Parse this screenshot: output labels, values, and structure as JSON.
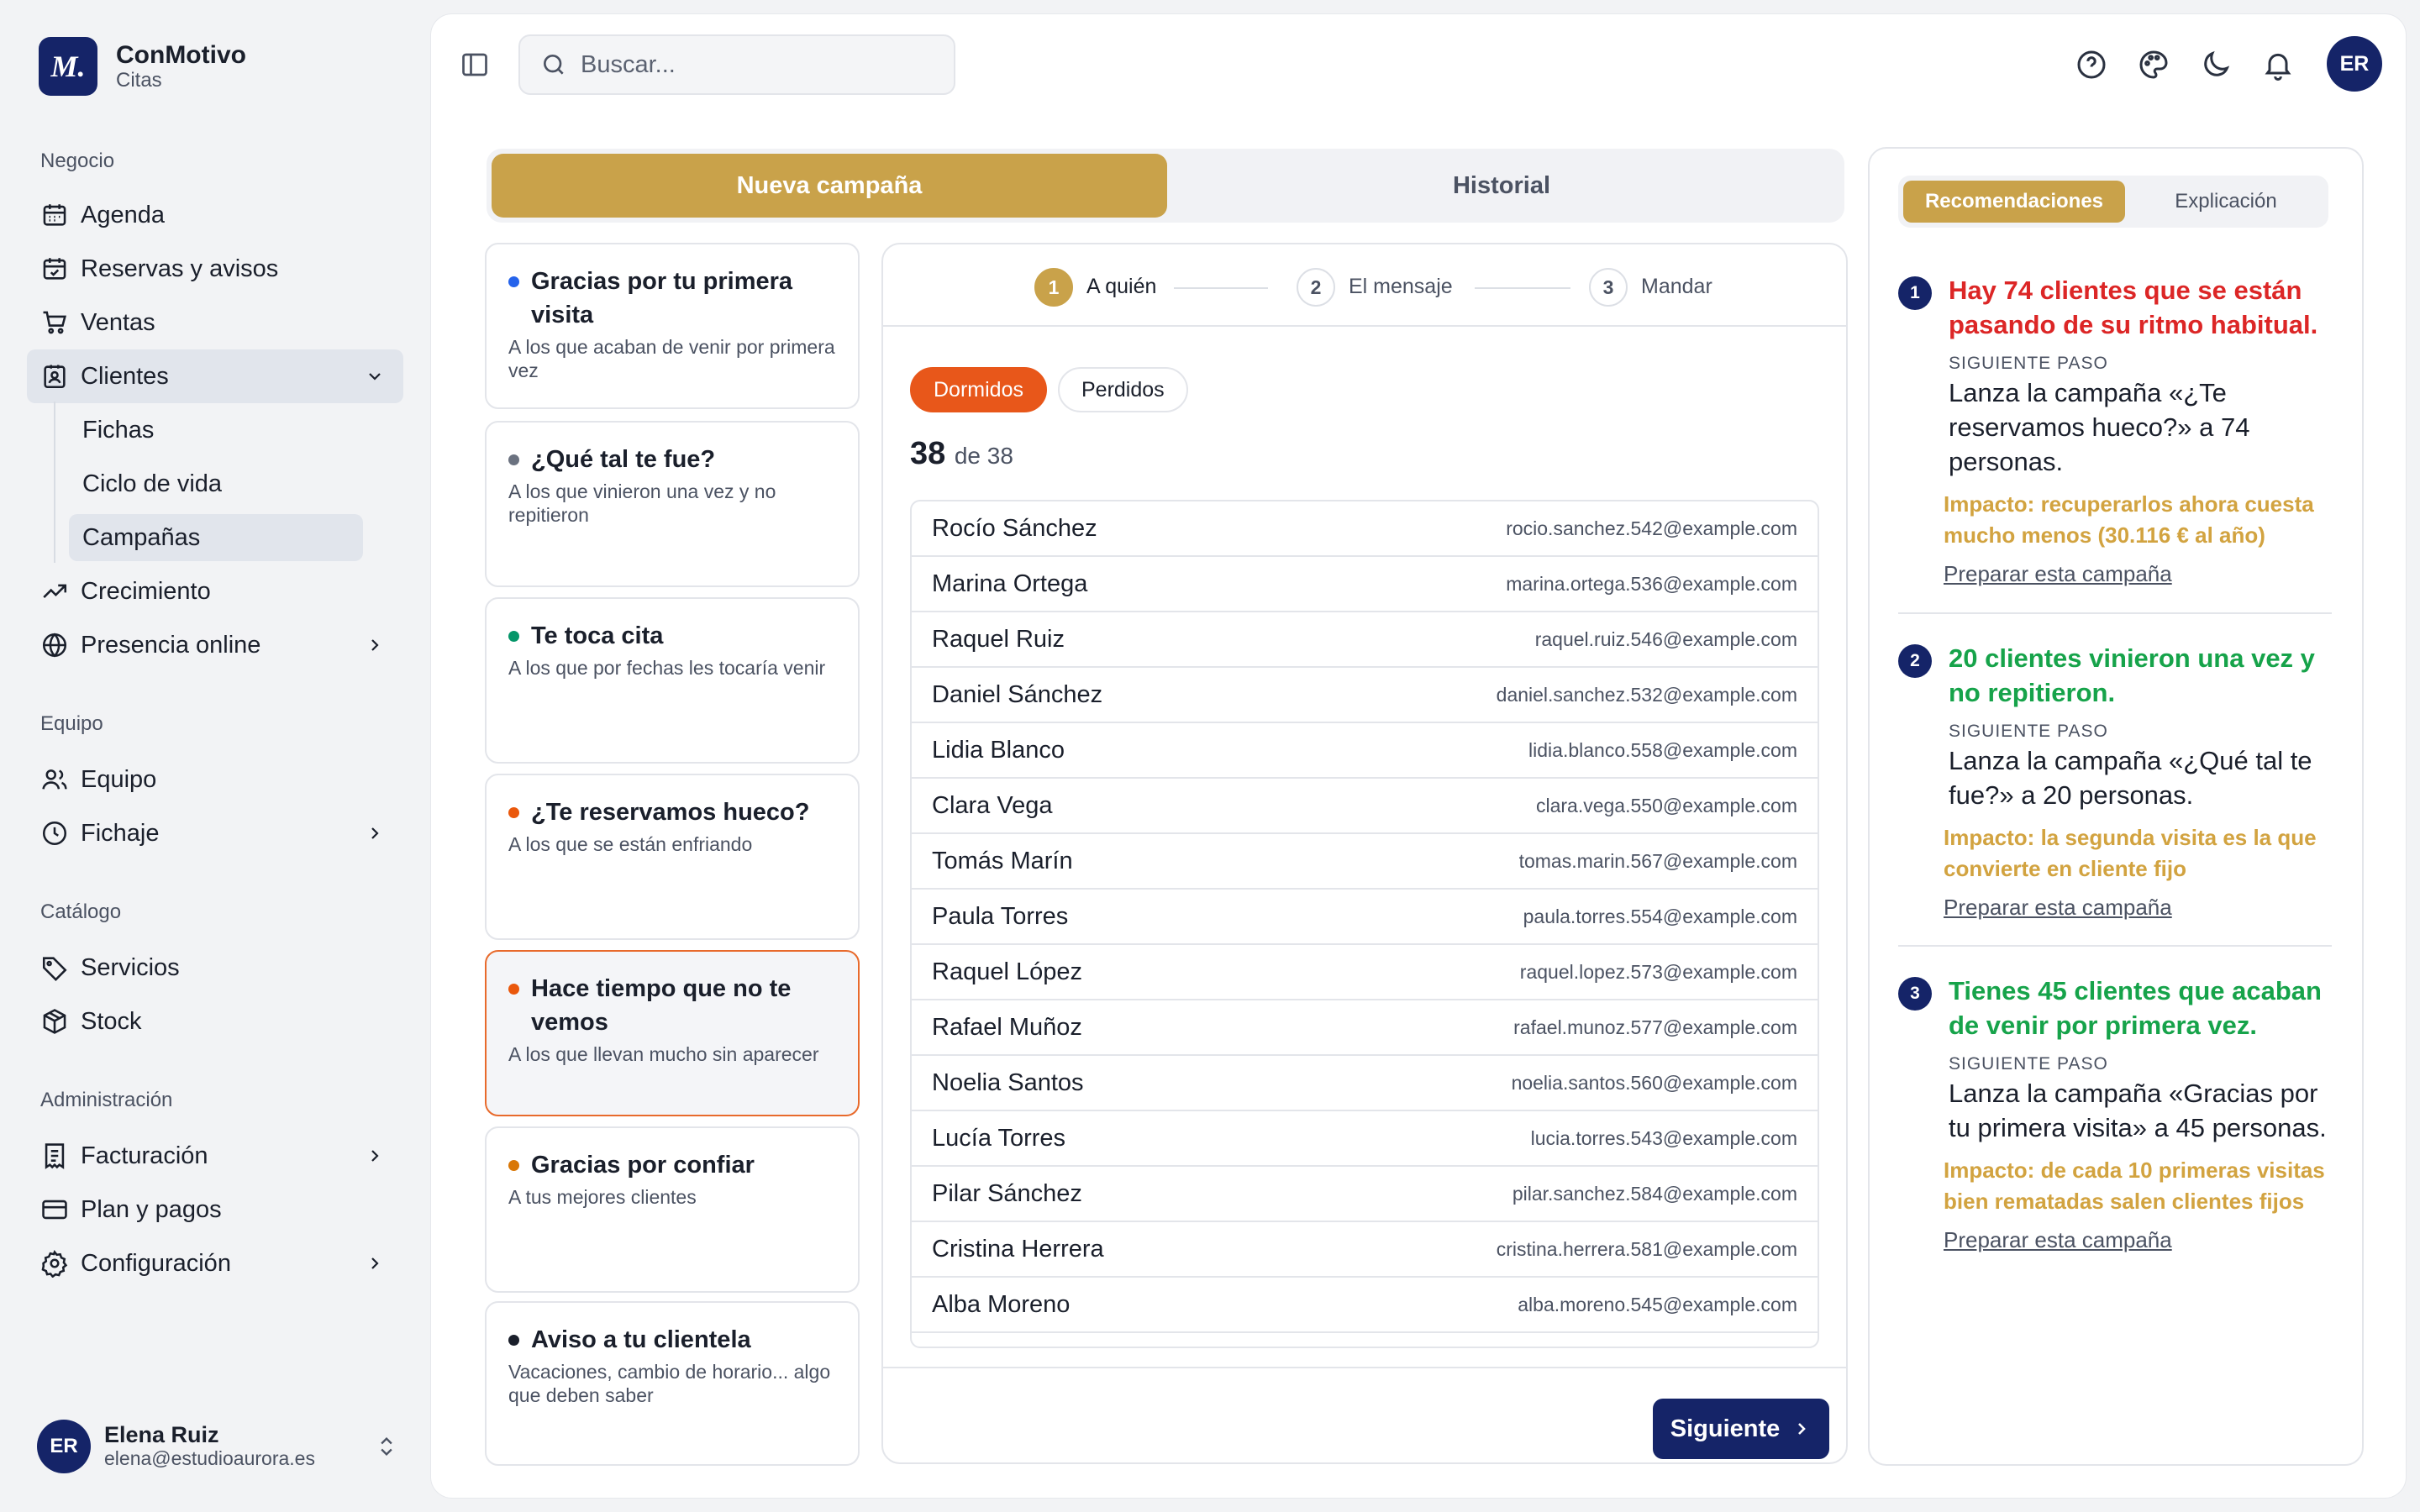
{
  "brand": {
    "logo": "M.",
    "name": "ConMotivo",
    "sub": "Citas"
  },
  "nav": {
    "sections": [
      "Negocio",
      "Equipo",
      "Catálogo",
      "Administración"
    ],
    "items": {
      "agenda": "Agenda",
      "reservas": "Reservas y avisos",
      "ventas": "Ventas",
      "clientes": "Clientes",
      "fichas": "Fichas",
      "ciclo": "Ciclo de vida",
      "campanas": "Campañas",
      "crecimiento": "Crecimiento",
      "presencia": "Presencia online",
      "equipo": "Equipo",
      "fichaje": "Fichaje",
      "servicios": "Servicios",
      "stock": "Stock",
      "facturacion": "Facturación",
      "plan": "Plan y pagos",
      "config": "Configuración"
    }
  },
  "user": {
    "initials": "ER",
    "name": "Elena Ruiz",
    "email": "elena@estudioaurora.es"
  },
  "search": {
    "placeholder": "Buscar..."
  },
  "topbar": {
    "avatar": "ER",
    "icons": [
      "help-icon",
      "palette-icon",
      "moon-icon",
      "bell-icon"
    ]
  },
  "tabs": {
    "new": "Nueva campaña",
    "history": "Historial"
  },
  "campaigns": [
    {
      "title": "Gracias por tu primera visita",
      "desc": "A los que acaban de venir por primera vez",
      "color": "#2563eb"
    },
    {
      "title": "¿Qué tal te fue?",
      "desc": "A los que vinieron una vez y no repitieron",
      "color": "#6b7280"
    },
    {
      "title": "Te toca cita",
      "desc": "A los que por fechas les tocaría venir",
      "color": "#059669"
    },
    {
      "title": "¿Te reservamos hueco?",
      "desc": "A los que se están enfriando",
      "color": "#ea580c"
    },
    {
      "title": "Hace tiempo que no te vemos",
      "desc": "A los que llevan mucho sin aparecer",
      "color": "#ea580c"
    },
    {
      "title": "Gracias por confiar",
      "desc": "A tus mejores clientes",
      "color": "#d97706"
    },
    {
      "title": "Aviso a tu clientela",
      "desc": "Vacaciones, cambio de horario... algo que deben saber",
      "color": "#1a1f2b"
    }
  ],
  "wizard": {
    "steps": [
      {
        "num": "1",
        "label": "A quién"
      },
      {
        "num": "2",
        "label": "El mensaje"
      },
      {
        "num": "3",
        "label": "Mandar"
      }
    ],
    "filters": {
      "active": "Dormidos",
      "other": "Perdidos"
    },
    "count": "38",
    "count_of": "de 38",
    "clients": [
      {
        "name": "Rocío Sánchez",
        "email": "rocio.sanchez.542@example.com"
      },
      {
        "name": "Marina Ortega",
        "email": "marina.ortega.536@example.com"
      },
      {
        "name": "Raquel Ruiz",
        "email": "raquel.ruiz.546@example.com"
      },
      {
        "name": "Daniel Sánchez",
        "email": "daniel.sanchez.532@example.com"
      },
      {
        "name": "Lidia Blanco",
        "email": "lidia.blanco.558@example.com"
      },
      {
        "name": "Clara Vega",
        "email": "clara.vega.550@example.com"
      },
      {
        "name": "Tomás Marín",
        "email": "tomas.marin.567@example.com"
      },
      {
        "name": "Paula Torres",
        "email": "paula.torres.554@example.com"
      },
      {
        "name": "Raquel López",
        "email": "raquel.lopez.573@example.com"
      },
      {
        "name": "Rafael Muñoz",
        "email": "rafael.munoz.577@example.com"
      },
      {
        "name": "Noelia Santos",
        "email": "noelia.santos.560@example.com"
      },
      {
        "name": "Lucía Torres",
        "email": "lucia.torres.543@example.com"
      },
      {
        "name": "Pilar Sánchez",
        "email": "pilar.sanchez.584@example.com"
      },
      {
        "name": "Cristina Herrera",
        "email": "cristina.herrera.581@example.com"
      },
      {
        "name": "Alba Moreno",
        "email": "alba.moreno.545@example.com"
      }
    ],
    "next": "Siguiente"
  },
  "reco": {
    "tabs": {
      "active": "Recomendaciones",
      "other": "Explicación"
    },
    "kicker": "SIGUIENTE PASO",
    "link": "Preparar esta campaña",
    "items": [
      {
        "num": "1",
        "title": "Hay 74 clientes que se están pasando de su ritmo habitual.",
        "title_color": "#dc2626",
        "step": "Lanza la campaña «¿Te reservamos hueco?» a 74 personas.",
        "impact": "Impacto: recuperarlos ahora cuesta mucho menos (30.116 € al año)"
      },
      {
        "num": "2",
        "title": "20 clientes vinieron una vez y no repitieron.",
        "title_color": "#16a34a",
        "step": "Lanza la campaña «¿Qué tal te fue?» a 20 personas.",
        "impact": "Impacto: la segunda visita es la que convierte en cliente fijo"
      },
      {
        "num": "3",
        "title": "Tienes 45 clientes que acaban de venir por primera vez.",
        "title_color": "#16a34a",
        "step": "Lanza la campaña «Gracias por tu primera visita» a 45 personas.",
        "impact": "Impacto: de cada 10 primeras visitas bien rematadas salen clientes fijos"
      }
    ]
  }
}
